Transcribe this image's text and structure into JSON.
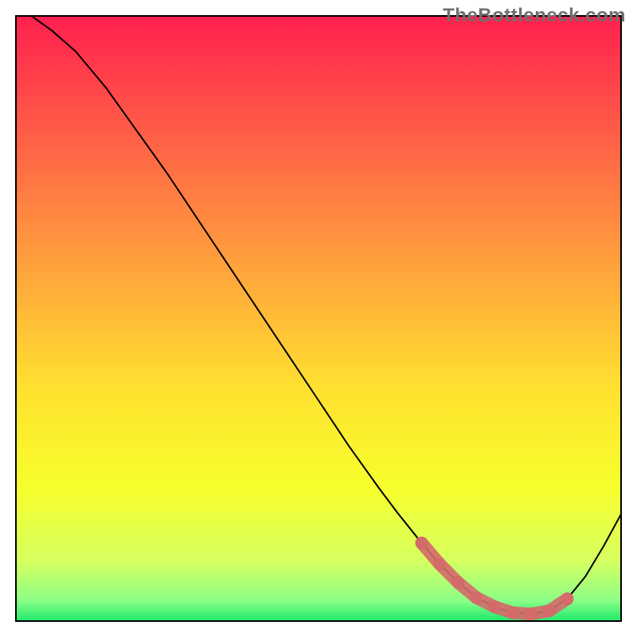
{
  "watermark": "TheBottleneck.com",
  "chart_data": {
    "type": "line",
    "title": "",
    "xlabel": "",
    "ylabel": "",
    "xlim": [
      0,
      100
    ],
    "ylim": [
      0,
      100
    ],
    "grid": false,
    "legend": false,
    "background_gradient": [
      {
        "pos": 0.0,
        "color": "#ff1f4e"
      },
      {
        "pos": 0.2,
        "color": "#ff5f47"
      },
      {
        "pos": 0.42,
        "color": "#ffa43c"
      },
      {
        "pos": 0.62,
        "color": "#ffe22f"
      },
      {
        "pos": 0.78,
        "color": "#f7ff2d"
      },
      {
        "pos": 0.9,
        "color": "#d6ff60"
      },
      {
        "pos": 0.965,
        "color": "#8cff86"
      },
      {
        "pos": 1.0,
        "color": "#19e86b"
      }
    ],
    "series": [
      {
        "name": "bottleneck-curve",
        "color": "#000000",
        "width": 2,
        "x": [
          2.5,
          6,
          10,
          15,
          20,
          25,
          30,
          35,
          40,
          45,
          50,
          55,
          60,
          63,
          67,
          70,
          73,
          76,
          79,
          82,
          85,
          88,
          91,
          94,
          97,
          100
        ],
        "y": [
          100,
          97.5,
          94,
          88,
          81,
          74,
          66.5,
          59,
          51.5,
          44,
          36.5,
          29,
          22,
          18,
          13,
          9.5,
          6.5,
          4,
          2.5,
          1.5,
          1.3,
          1.8,
          3.8,
          7.5,
          12.5,
          18
        ]
      }
    ],
    "highlight": {
      "name": "sweet-spot",
      "color": "#d46a6a",
      "radius": 8,
      "x": [
        67,
        70,
        73,
        76,
        79,
        82,
        85,
        88,
        91
      ],
      "y": [
        13,
        9.5,
        6.5,
        4,
        2.5,
        1.5,
        1.3,
        1.8,
        3.8
      ]
    }
  }
}
